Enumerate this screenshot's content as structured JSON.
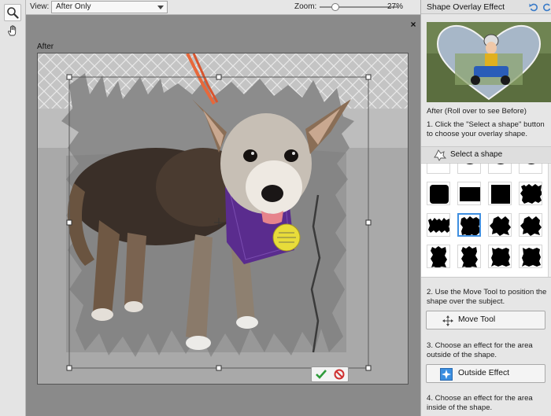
{
  "toolbar": {
    "tools": [
      {
        "name": "zoom-tool",
        "icon": "magnifier-icon"
      },
      {
        "name": "hand-tool",
        "icon": "hand-icon"
      }
    ]
  },
  "options": {
    "view_label": "View:",
    "view_value": "After Only",
    "zoom_label": "Zoom:",
    "zoom_value": "27%",
    "zoom_level_percent": 27
  },
  "canvas": {
    "label": "After",
    "close_symbol": "×"
  },
  "panel": {
    "title": "Shape Overlay Effect",
    "preview_caption": "After (Roll over to see Before)",
    "step1": "1. Click the \"Select a shape\" button to choose your overlay shape.",
    "select_shape_label": "Select a shape",
    "step2": "2. Use the Move Tool to position the shape over the subject.",
    "move_tool_label": "Move Tool",
    "step3": "3. Choose an effect for the area outside of the shape.",
    "outside_effect_label": "Outside Effect",
    "step4": "4. Choose an effect for the area inside of the shape."
  },
  "shapes": [
    "semicircle-shape",
    "arc-shape",
    "arc-shape",
    "arc-shape",
    "rounded-square-shape",
    "bar-square-shape",
    "square-shape",
    "grunge-square-shape",
    "torn-strip-shape",
    "torn-square-shape",
    "splatter-shape",
    "splatter-shape",
    "torn-tall-shape",
    "torn-tall-shape",
    "rough-rect-shape",
    "rough-rect-shape"
  ],
  "selected_shape_index": 9,
  "colors": {
    "accent": "#3f8fe0",
    "commit_green": "#2e9b3a",
    "cancel_red": "#d03030",
    "tag_yellow": "#e8dc3a",
    "harness_purple": "#5a2c8e"
  }
}
